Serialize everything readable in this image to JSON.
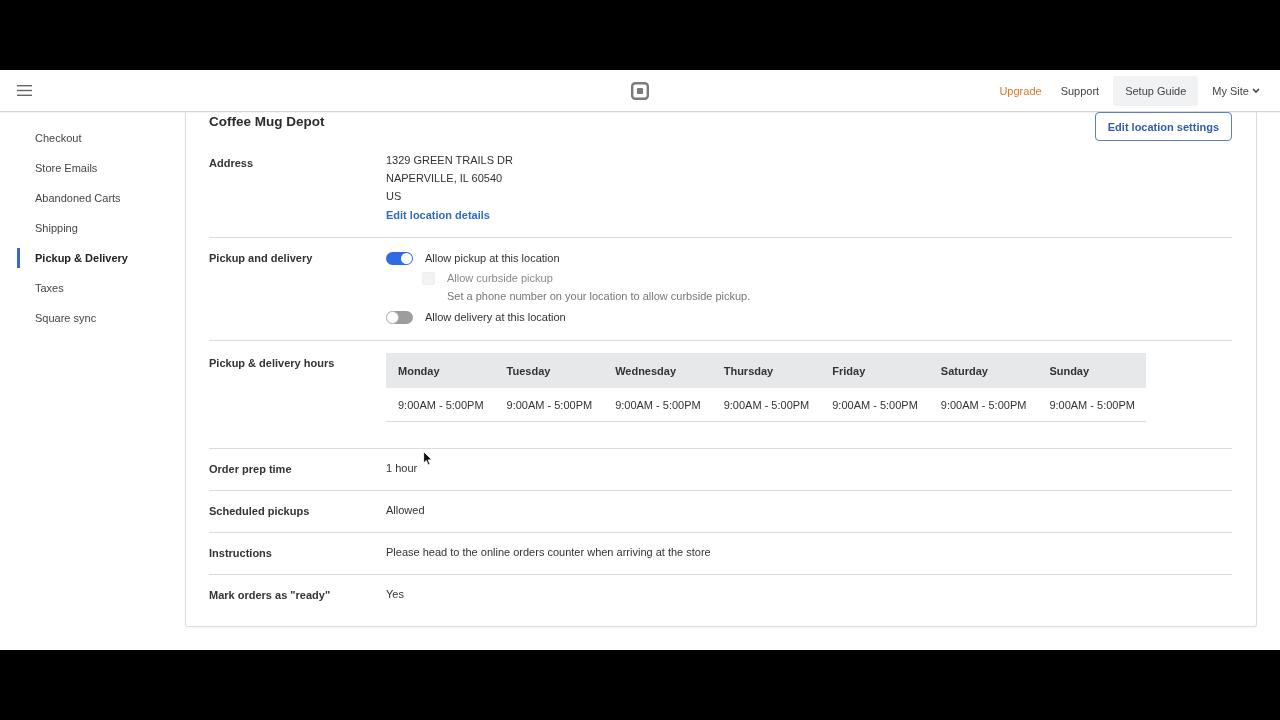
{
  "header": {
    "links": [
      {
        "label": "Upgrade",
        "kind": "upgrade"
      },
      {
        "label": "Support",
        "kind": "plain"
      },
      {
        "label": "Setup Guide",
        "kind": "boxed"
      },
      {
        "label": "My Site",
        "kind": "menu"
      }
    ]
  },
  "sidebar": {
    "items": [
      {
        "label": "Checkout",
        "selected": false
      },
      {
        "label": "Store Emails",
        "selected": false
      },
      {
        "label": "Abandoned Carts",
        "selected": false
      },
      {
        "label": "Shipping",
        "selected": false
      },
      {
        "label": "Pickup & Delivery",
        "selected": true
      },
      {
        "label": "Taxes",
        "selected": false
      },
      {
        "label": "Square sync",
        "selected": false
      }
    ]
  },
  "location": {
    "name": "Coffee Mug Depot",
    "edit_button": "Edit location settings",
    "address": {
      "label": "Address",
      "lines": [
        "1329 GREEN TRAILS DR",
        "NAPERVILLE, IL 60540",
        "US"
      ],
      "link": "Edit location details"
    },
    "pickup_delivery": {
      "label": "Pickup and delivery",
      "options": [
        {
          "kind": "toggle",
          "label": "Allow pickup at this location",
          "on": true,
          "disabled": false
        },
        {
          "kind": "checkbox",
          "label": "Allow curbside pickup",
          "on": false,
          "disabled": true,
          "help": "Set a phone number on your location to allow curbside pickup."
        },
        {
          "kind": "toggle",
          "label": "Allow delivery at this location",
          "on": false,
          "disabled": false
        }
      ]
    },
    "hours": {
      "label": "Pickup & delivery hours",
      "table": {
        "columns": [
          "Monday",
          "Tuesday",
          "Wednesday",
          "Thursday",
          "Friday",
          "Saturday",
          "Sunday"
        ],
        "rows": [
          [
            "9:00AM - 5:00PM",
            "9:00AM - 5:00PM",
            "9:00AM - 5:00PM",
            "9:00AM - 5:00PM",
            "9:00AM - 5:00PM",
            "9:00AM - 5:00PM",
            "9:00AM - 5:00PM"
          ]
        ]
      }
    },
    "details": [
      {
        "label": "Order prep time",
        "value": "1 hour"
      },
      {
        "label": "Scheduled pickups",
        "value": "Allowed"
      },
      {
        "label": "Instructions",
        "value": "Please head to the online orders counter when arriving at the store"
      },
      {
        "label": "Mark orders as \"ready\"",
        "value": "Yes"
      }
    ]
  }
}
